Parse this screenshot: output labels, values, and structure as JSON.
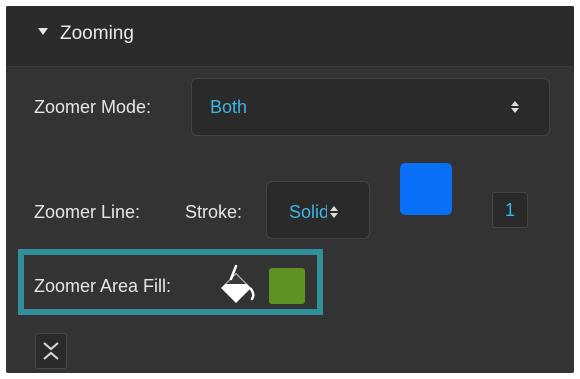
{
  "section": {
    "title": "Zooming",
    "expanded": true
  },
  "zoomer_mode": {
    "label": "Zoomer Mode:",
    "value": "Both"
  },
  "zoomer_line": {
    "label": "Zoomer Line:",
    "stroke_label": "Stroke:",
    "stroke_value": "Solid",
    "color": "#0a6ff7",
    "width_value": "1"
  },
  "zoomer_area_fill": {
    "label": "Zoomer Area Fill:",
    "color": "#5e9324"
  },
  "colors": {
    "panel_bg": "#333333",
    "accent_text": "#3db5e6",
    "highlight_border": "#2f8f9b"
  },
  "icons": {
    "section_toggle": "caret-down-icon",
    "fill_bucket": "paint-bucket-icon",
    "collapse": "collapse-icon"
  }
}
